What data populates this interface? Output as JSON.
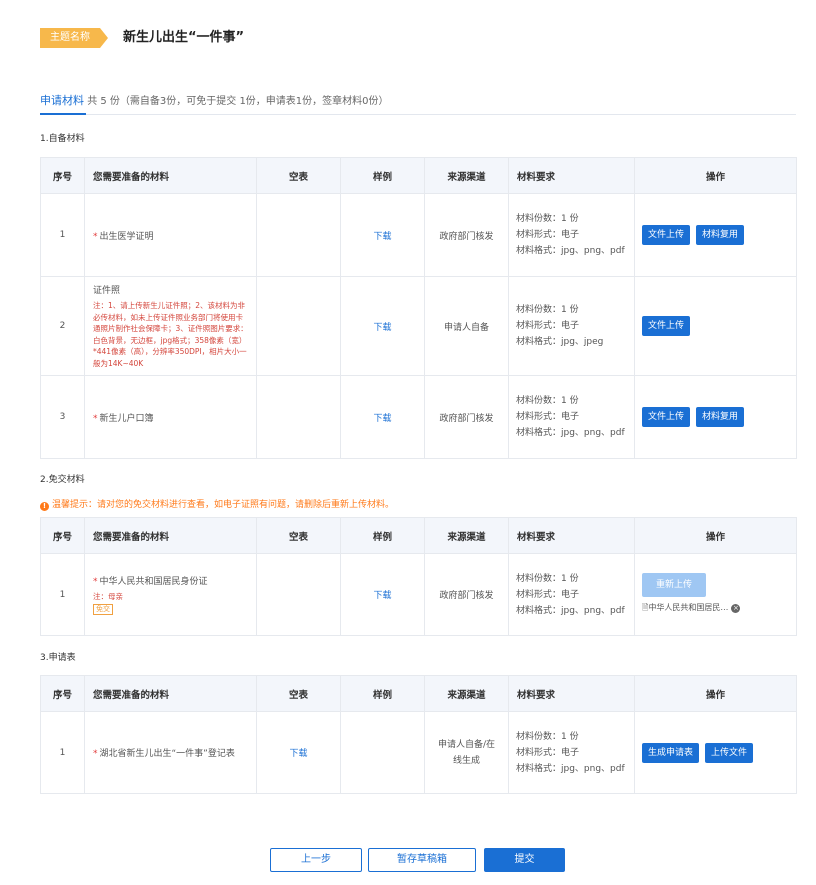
{
  "header": {
    "tag": "主题名称",
    "title": "新生儿出生“一件事”"
  },
  "tab": {
    "name": "申请材料",
    "summary": "共 5 份（需自备3份，可免于提交 1份，申请表1份，签章材料0份）"
  },
  "columns": {
    "seq": "序号",
    "material": "您需要准备的材料",
    "blank": "空表",
    "sample": "样例",
    "source": "来源渠道",
    "req": "材料要求",
    "ops": "操作"
  },
  "section1": {
    "title": "1.自备材料",
    "rows": [
      {
        "seq": "1",
        "name": "出生医学证明",
        "required": true,
        "sample": "下载",
        "source": "政府部门核发",
        "req": [
          "材料份数：1 份",
          "材料形式：电子",
          "材料格式：jpg、png、pdf"
        ],
        "btn1": "文件上传",
        "btn2": "材料复用"
      },
      {
        "seq": "2",
        "name": "证件照",
        "required": false,
        "note": "注：1、请上传新生儿证件照；2、该材料为非必传材料，如未上传证件照业务部门将使用卡通照片制作社会保障卡；3、证件照图片要求：白色背景，无边框，jpg格式；358像素（宽）*441像素（高），分辨率350DPI，相片大小一般为14K~40K",
        "sample": "下载",
        "source": "申请人自备",
        "req": [
          "材料份数：1 份",
          "材料形式：电子",
          "材料格式：jpg、jpeg"
        ],
        "btn1": "文件上传"
      },
      {
        "seq": "3",
        "name": "新生儿户口簿",
        "required": true,
        "sample": "下载",
        "source": "政府部门核发",
        "req": [
          "材料份数：1 份",
          "材料形式：电子",
          "材料格式：jpg、png、pdf"
        ],
        "btn1": "文件上传",
        "btn2": "材料复用"
      }
    ]
  },
  "section2": {
    "title": "2.免交材料",
    "warning": "温馨提示：请对您的免交材料进行查看，如电子证照有问题，请删除后重新上传材料。",
    "warning_icon": "!",
    "rows": [
      {
        "seq": "1",
        "name": "中华人民共和国居民身份证",
        "required": true,
        "note": "注：母亲",
        "badge": "免交",
        "sample": "下载",
        "source": "政府部门核发",
        "req": [
          "材料份数：1 份",
          "材料形式：电子",
          "材料格式：jpg、png、pdf"
        ],
        "btn": "重新上传",
        "file": "中华人民共和国居民…",
        "file_remove": "×"
      }
    ]
  },
  "section3": {
    "title": "3.申请表",
    "rows": [
      {
        "seq": "1",
        "name": "湖北省新生儿出生“一件事”登记表",
        "required": true,
        "blank": "下载",
        "source": "申请人自备/在线生成",
        "req": [
          "材料份数：1 份",
          "材料形式：电子",
          "材料格式：jpg、png、pdf"
        ],
        "btn1": "生成申请表",
        "btn2": "上传文件"
      }
    ]
  },
  "footer": {
    "prev": "上一步",
    "draft": "暂存草稿箱",
    "submit": "提交"
  },
  "colors": {
    "primary": "#1a6fd4",
    "tag": "#f7b84b",
    "warning": "#ff7a1a",
    "required": "#e23c3c"
  }
}
